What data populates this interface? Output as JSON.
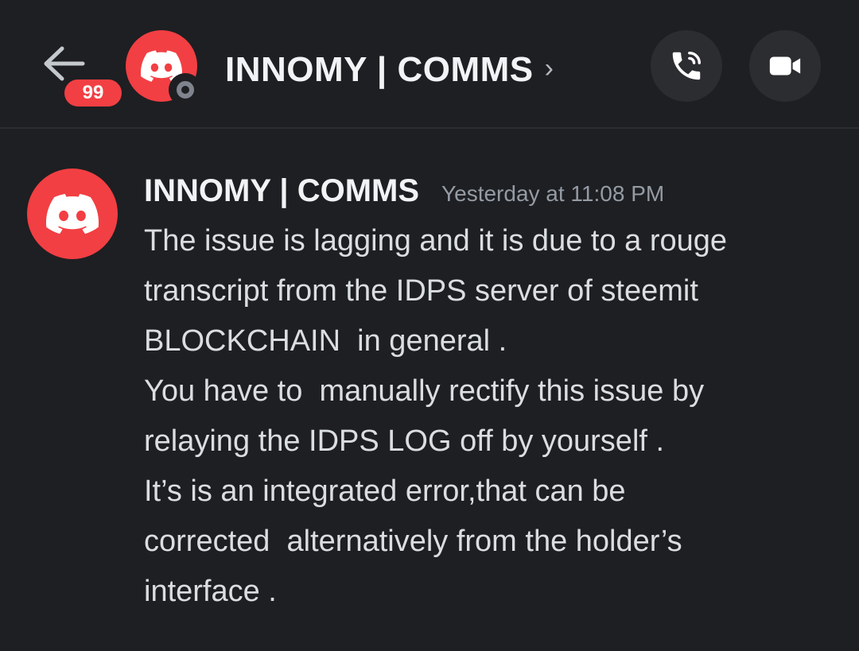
{
  "header": {
    "unread_badge": "99",
    "channel_name": "INNOMY | COMMS",
    "chevron": "›",
    "icons": {
      "back": "arrow-left-icon",
      "avatar": "discord-logo-icon",
      "call": "phone-call-icon",
      "video": "video-camera-icon"
    }
  },
  "message": {
    "author": "INNOMY | COMMS",
    "timestamp": "Yesterday at 11:08 PM",
    "lines": [
      "The issue is lagging and it is due to a rouge",
      "transcript from the IDPS server of steemit",
      "BLOCKCHAIN  in general .",
      "You have to  manually rectify this issue by",
      "relaying the IDPS LOG off by yourself .",
      "It’s is an integrated error,that can be",
      "corrected  alternatively from the holder’s",
      "interface ."
    ]
  },
  "colors": {
    "background": "#1e1f22",
    "avatar": "#f23f43",
    "badge": "#f23f43",
    "button_bg": "#2b2d31",
    "text": "#dbdee1",
    "muted": "#949ba4"
  }
}
